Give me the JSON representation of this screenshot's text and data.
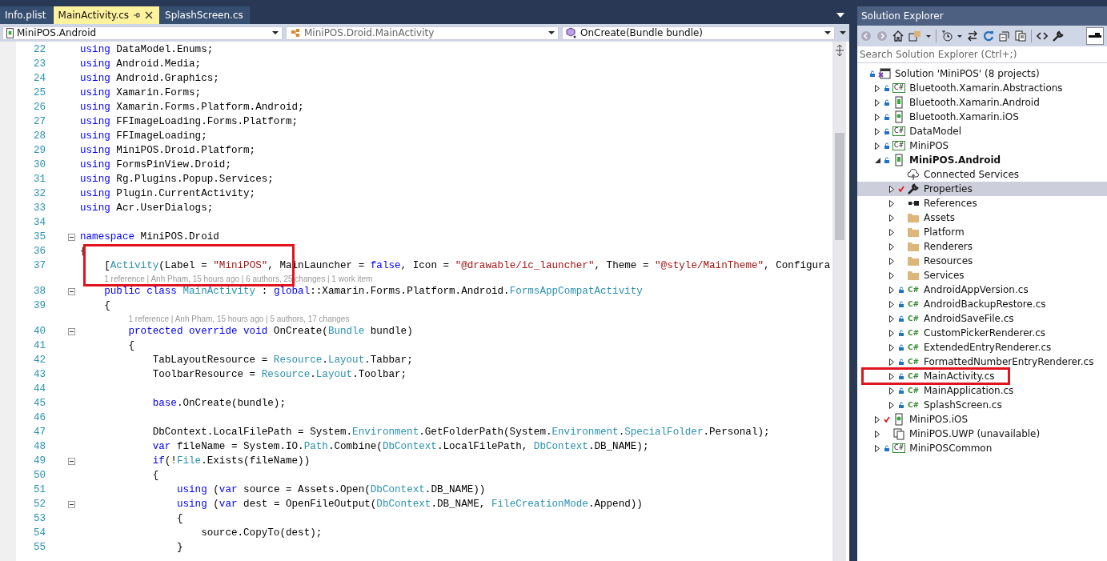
{
  "tabs": [
    {
      "label": "Info.plist",
      "selected": false
    },
    {
      "label": "MainActivity.cs",
      "selected": true
    },
    {
      "label": "SplashScreen.cs",
      "selected": false
    }
  ],
  "nav": [
    {
      "label": "MiniPOS.Android",
      "kind": "project",
      "dimmed": false
    },
    {
      "label": "MiniPOS.Droid.MainActivity",
      "kind": "class",
      "dimmed": true
    },
    {
      "label": "OnCreate(Bundle bundle)",
      "kind": "member",
      "dimmed": false
    }
  ],
  "editor": {
    "lines": [
      {
        "num": "22",
        "fold": false,
        "highlighted": false,
        "tokens": [
          {
            "kind": "kw",
            "t": "using"
          },
          {
            "kind": "plain",
            "t": " DataModel.Enums;"
          }
        ]
      },
      {
        "num": "23",
        "fold": false,
        "highlighted": false,
        "tokens": [
          {
            "kind": "kw",
            "t": "using"
          },
          {
            "kind": "plain",
            "t": " Android.Media;"
          }
        ]
      },
      {
        "num": "24",
        "fold": false,
        "highlighted": false,
        "tokens": [
          {
            "kind": "kw",
            "t": "using"
          },
          {
            "kind": "plain",
            "t": " Android.Graphics;"
          }
        ]
      },
      {
        "num": "25",
        "fold": false,
        "highlighted": false,
        "tokens": [
          {
            "kind": "kw",
            "t": "using"
          },
          {
            "kind": "plain",
            "t": " Xamarin.Forms;"
          }
        ]
      },
      {
        "num": "26",
        "fold": false,
        "highlighted": false,
        "tokens": [
          {
            "kind": "kw",
            "t": "using"
          },
          {
            "kind": "plain",
            "t": " Xamarin.Forms.Platform.Android;"
          }
        ]
      },
      {
        "num": "27",
        "fold": false,
        "highlighted": false,
        "tokens": [
          {
            "kind": "kw",
            "t": "using"
          },
          {
            "kind": "plain",
            "t": " FFImageLoading.Forms.Platform;"
          }
        ]
      },
      {
        "num": "28",
        "fold": false,
        "highlighted": false,
        "tokens": [
          {
            "kind": "kw",
            "t": "using"
          },
          {
            "kind": "plain",
            "t": " FFImageLoading;"
          }
        ]
      },
      {
        "num": "29",
        "fold": false,
        "highlighted": false,
        "tokens": [
          {
            "kind": "kw",
            "t": "using"
          },
          {
            "kind": "plain",
            "t": " MiniPOS.Droid.Platform;"
          }
        ]
      },
      {
        "num": "30",
        "fold": false,
        "highlighted": false,
        "tokens": [
          {
            "kind": "kw",
            "t": "using"
          },
          {
            "kind": "plain",
            "t": " FormsPinView.Droid;"
          }
        ]
      },
      {
        "num": "31",
        "fold": false,
        "highlighted": false,
        "tokens": [
          {
            "kind": "kw",
            "t": "using"
          },
          {
            "kind": "plain",
            "t": " Rg.Plugins.Popup.Services;"
          }
        ]
      },
      {
        "num": "32",
        "fold": false,
        "highlighted": false,
        "tokens": [
          {
            "kind": "kw",
            "t": "using"
          },
          {
            "kind": "plain",
            "t": " Plugin.CurrentActivity;"
          }
        ]
      },
      {
        "num": "33",
        "fold": false,
        "highlighted": false,
        "tokens": [
          {
            "kind": "kw",
            "t": "using"
          },
          {
            "kind": "plain",
            "t": " Acr.UserDialogs;"
          }
        ]
      },
      {
        "num": "34",
        "fold": false,
        "highlighted": false
      },
      {
        "num": "35",
        "fold": true,
        "highlighted": false,
        "tokens": [
          {
            "kind": "kw",
            "t": "namespace"
          },
          {
            "kind": "plain",
            "t": " MiniPOS.Droid"
          }
        ]
      },
      {
        "num": "36",
        "fold": false,
        "highlighted": false,
        "tokens": [
          {
            "kind": "plain",
            "t": "{"
          }
        ]
      },
      {
        "num": "37",
        "fold": false,
        "highlighted": true,
        "tokens": [
          {
            "kind": "plain",
            "t": "    ["
          },
          {
            "kind": "type",
            "t": "Activity"
          },
          {
            "kind": "plain",
            "t": "(Label = "
          },
          {
            "kind": "str",
            "t": "\"MiniPOS\""
          },
          {
            "kind": "plain",
            "t": ", MainLauncher = "
          },
          {
            "kind": "kw",
            "t": "false"
          },
          {
            "kind": "plain",
            "t": ", Icon = "
          },
          {
            "kind": "str",
            "t": "\"@drawable/ic_launcher\""
          },
          {
            "kind": "plain",
            "t": ", Theme = "
          },
          {
            "kind": "str",
            "t": "\"@style/MainTheme\""
          },
          {
            "kind": "plain",
            "t": ", Configura"
          }
        ]
      },
      {
        "num": "38",
        "fold": true,
        "highlighted": false,
        "lens": "1 reference | Anh Pham, 15 hours ago | 6 authors, 25 changes | 1 work item",
        "tokens": [
          {
            "kind": "kw",
            "t": "    public class "
          },
          {
            "kind": "type",
            "t": "MainActivity"
          },
          {
            "kind": "plain",
            "t": " : "
          },
          {
            "kind": "kw",
            "t": "global"
          },
          {
            "kind": "plain",
            "t": "::Xamarin.Forms.Platform.Android."
          },
          {
            "kind": "type",
            "t": "FormsAppCompatActivity"
          }
        ]
      },
      {
        "num": "39",
        "fold": false,
        "highlighted": false,
        "tokens": [
          {
            "kind": "plain",
            "t": "    {"
          }
        ]
      },
      {
        "num": "40",
        "fold": true,
        "highlighted": false,
        "lens": "1 reference | Anh Pham, 15 hours ago | 5 authors, 17 changes",
        "tokens": [
          {
            "kind": "kw",
            "t": "        protected override void"
          },
          {
            "kind": "plain",
            "t": " OnCreate("
          },
          {
            "kind": "type",
            "t": "Bundle"
          },
          {
            "kind": "plain",
            "t": " bundle)"
          }
        ]
      },
      {
        "num": "41",
        "fold": false,
        "highlighted": false,
        "tokens": [
          {
            "kind": "plain",
            "t": "        {"
          }
        ]
      },
      {
        "num": "42",
        "fold": false,
        "highlighted": false,
        "tokens": [
          {
            "kind": "plain",
            "t": "            TabLayoutResource = "
          },
          {
            "kind": "type",
            "t": "Resource"
          },
          {
            "kind": "plain",
            "t": "."
          },
          {
            "kind": "type",
            "t": "Layout"
          },
          {
            "kind": "plain",
            "t": ".Tabbar;"
          }
        ]
      },
      {
        "num": "43",
        "fold": false,
        "highlighted": false,
        "tokens": [
          {
            "kind": "plain",
            "t": "            ToolbarResource = "
          },
          {
            "kind": "type",
            "t": "Resource"
          },
          {
            "kind": "plain",
            "t": "."
          },
          {
            "kind": "type",
            "t": "Layout"
          },
          {
            "kind": "plain",
            "t": ".Toolbar;"
          }
        ]
      },
      {
        "num": "44",
        "fold": false,
        "highlighted": false
      },
      {
        "num": "45",
        "fold": false,
        "highlighted": false,
        "tokens": [
          {
            "kind": "kw",
            "t": "            base"
          },
          {
            "kind": "plain",
            "t": ".OnCreate(bundle);"
          }
        ]
      },
      {
        "num": "46",
        "fold": false,
        "highlighted": false
      },
      {
        "num": "47",
        "fold": false,
        "highlighted": false,
        "tokens": [
          {
            "kind": "plain",
            "t": "            DbContext.LocalFilePath = System."
          },
          {
            "kind": "type",
            "t": "Environment"
          },
          {
            "kind": "plain",
            "t": ".GetFolderPath(System."
          },
          {
            "kind": "type",
            "t": "Environment"
          },
          {
            "kind": "plain",
            "t": "."
          },
          {
            "kind": "type",
            "t": "SpecialFolder"
          },
          {
            "kind": "plain",
            "t": ".Personal);"
          }
        ]
      },
      {
        "num": "48",
        "fold": false,
        "highlighted": false,
        "tokens": [
          {
            "kind": "kw",
            "t": "            var"
          },
          {
            "kind": "plain",
            "t": " fileName = System.IO."
          },
          {
            "kind": "type",
            "t": "Path"
          },
          {
            "kind": "plain",
            "t": ".Combine("
          },
          {
            "kind": "type",
            "t": "DbContext"
          },
          {
            "kind": "plain",
            "t": ".LocalFilePath, "
          },
          {
            "kind": "type",
            "t": "DbContext"
          },
          {
            "kind": "plain",
            "t": ".DB_NAME);"
          }
        ]
      },
      {
        "num": "49",
        "fold": true,
        "highlighted": false,
        "tokens": [
          {
            "kind": "kw",
            "t": "            if"
          },
          {
            "kind": "plain",
            "t": "(!"
          },
          {
            "kind": "type",
            "t": "File"
          },
          {
            "kind": "plain",
            "t": ".Exists(fileName))"
          }
        ]
      },
      {
        "num": "50",
        "fold": false,
        "highlighted": false,
        "tokens": [
          {
            "kind": "plain",
            "t": "            {"
          }
        ]
      },
      {
        "num": "51",
        "fold": false,
        "highlighted": false,
        "tokens": [
          {
            "kind": "kw",
            "t": "                using"
          },
          {
            "kind": "plain",
            "t": " ("
          },
          {
            "kind": "kw",
            "t": "var"
          },
          {
            "kind": "plain",
            "t": " source = Assets.Open("
          },
          {
            "kind": "type",
            "t": "DbContext"
          },
          {
            "kind": "plain",
            "t": ".DB_NAME))"
          }
        ]
      },
      {
        "num": "52",
        "fold": true,
        "highlighted": false,
        "tokens": [
          {
            "kind": "kw",
            "t": "                using"
          },
          {
            "kind": "plain",
            "t": " ("
          },
          {
            "kind": "kw",
            "t": "var"
          },
          {
            "kind": "plain",
            "t": " dest = OpenFileOutput("
          },
          {
            "kind": "type",
            "t": "DbContext"
          },
          {
            "kind": "plain",
            "t": ".DB_NAME, "
          },
          {
            "kind": "type",
            "t": "FileCreationMode"
          },
          {
            "kind": "plain",
            "t": ".Append))"
          }
        ]
      },
      {
        "num": "53",
        "fold": false,
        "highlighted": false,
        "tokens": [
          {
            "kind": "plain",
            "t": "                {"
          }
        ]
      },
      {
        "num": "54",
        "fold": false,
        "highlighted": false,
        "tokens": [
          {
            "kind": "plain",
            "t": "                    source.CopyTo(dest);"
          }
        ]
      },
      {
        "num": "55",
        "fold": false,
        "highlighted": false,
        "tokens": [
          {
            "kind": "plain",
            "t": "                }"
          }
        ]
      }
    ]
  },
  "explorer": {
    "title": "Solution Explorer",
    "search": {
      "placeholder": "Search Solution Explorer (Ctrl+;)"
    },
    "tree": [
      {
        "label": "Solution 'MiniPOS' (8 projects)",
        "kind": "solution",
        "locked": true,
        "pending": false,
        "bold": false,
        "selected": false,
        "highlighted": false,
        "children": [
          {
            "label": "Bluetooth.Xamarin.Abstractions",
            "kind": "csproj",
            "badge": "C#",
            "locked": true,
            "pending": false,
            "bold": false,
            "selected": false,
            "highlighted": false,
            "expanded": false
          },
          {
            "label": "Bluetooth.Xamarin.Android",
            "kind": "android",
            "locked": true,
            "pending": false,
            "bold": false,
            "selected": false,
            "highlighted": false,
            "expanded": false
          },
          {
            "label": "Bluetooth.Xamarin.iOS",
            "kind": "ios",
            "locked": true,
            "pending": false,
            "bold": false,
            "selected": false,
            "highlighted": false,
            "expanded": false
          },
          {
            "label": "DataModel",
            "kind": "csproj",
            "badge": "C#",
            "locked": true,
            "pending": false,
            "bold": false,
            "selected": false,
            "highlighted": false,
            "expanded": false
          },
          {
            "label": "MiniPOS",
            "kind": "csproj",
            "badge": "C#",
            "locked": true,
            "pending": false,
            "bold": false,
            "selected": false,
            "highlighted": false,
            "expanded": false
          },
          {
            "label": "MiniPOS.Android",
            "kind": "android",
            "locked": true,
            "pending": false,
            "bold": true,
            "selected": false,
            "highlighted": false,
            "expanded": true,
            "children": [
              {
                "label": "Connected Services",
                "kind": "connected",
                "locked": false,
                "pending": false,
                "bold": false,
                "selected": false,
                "highlighted": false
              },
              {
                "label": "Properties",
                "kind": "wrench",
                "locked": false,
                "pending": true,
                "bold": false,
                "selected": true,
                "highlighted": false,
                "expanded": false
              },
              {
                "label": "References",
                "kind": "references",
                "locked": false,
                "pending": false,
                "bold": false,
                "selected": false,
                "highlighted": false,
                "expanded": false
              },
              {
                "label": "Assets",
                "kind": "folder",
                "locked": false,
                "pending": false,
                "bold": false,
                "selected": false,
                "highlighted": false,
                "expanded": false
              },
              {
                "label": "Platform",
                "kind": "folder",
                "locked": false,
                "pending": false,
                "bold": false,
                "selected": false,
                "highlighted": false,
                "expanded": false
              },
              {
                "label": "Renderers",
                "kind": "folder",
                "locked": false,
                "pending": false,
                "bold": false,
                "selected": false,
                "highlighted": false,
                "expanded": false
              },
              {
                "label": "Resources",
                "kind": "folder",
                "locked": false,
                "pending": false,
                "bold": false,
                "selected": false,
                "highlighted": false,
                "expanded": false
              },
              {
                "label": "Services",
                "kind": "folder",
                "locked": false,
                "pending": false,
                "bold": false,
                "selected": false,
                "highlighted": false,
                "expanded": false
              },
              {
                "label": "AndroidAppVersion.cs",
                "kind": "cs",
                "badge": "C#",
                "locked": true,
                "pending": false,
                "bold": false,
                "selected": false,
                "highlighted": false,
                "expanded": false
              },
              {
                "label": "AndroidBackupRestore.cs",
                "kind": "cs",
                "badge": "C#",
                "locked": true,
                "pending": false,
                "bold": false,
                "selected": false,
                "highlighted": false,
                "expanded": false
              },
              {
                "label": "AndroidSaveFile.cs",
                "kind": "cs",
                "badge": "C#",
                "locked": true,
                "pending": false,
                "bold": false,
                "selected": false,
                "highlighted": false,
                "expanded": false
              },
              {
                "label": "CustomPickerRenderer.cs",
                "kind": "cs",
                "badge": "C#",
                "locked": true,
                "pending": false,
                "bold": false,
                "selected": false,
                "highlighted": false,
                "expanded": false
              },
              {
                "label": "ExtendedEntryRenderer.cs",
                "kind": "cs",
                "badge": "C#",
                "locked": true,
                "pending": false,
                "bold": false,
                "selected": false,
                "highlighted": false,
                "expanded": false
              },
              {
                "label": "FormattedNumberEntryRenderer.cs",
                "kind": "cs",
                "badge": "C#",
                "locked": true,
                "pending": false,
                "bold": false,
                "selected": false,
                "highlighted": false,
                "expanded": false
              },
              {
                "label": "MainActivity.cs",
                "kind": "cs",
                "badge": "C#",
                "locked": true,
                "pending": false,
                "bold": false,
                "selected": false,
                "highlighted": true,
                "expanded": false
              },
              {
                "label": "MainApplication.cs",
                "kind": "cs",
                "badge": "C#",
                "locked": true,
                "pending": false,
                "bold": false,
                "selected": false,
                "highlighted": false,
                "expanded": false
              },
              {
                "label": "SplashScreen.cs",
                "kind": "cs",
                "badge": "C#",
                "locked": true,
                "pending": false,
                "bold": false,
                "selected": false,
                "highlighted": false,
                "expanded": false
              }
            ]
          },
          {
            "label": "MiniPOS.iOS",
            "kind": "ios",
            "locked": false,
            "pending": true,
            "bold": false,
            "selected": false,
            "highlighted": false,
            "expanded": false
          },
          {
            "label": "MiniPOS.UWP (unavailable)",
            "kind": "uwp",
            "locked": false,
            "pending": false,
            "bold": false,
            "selected": false,
            "highlighted": false,
            "expanded": false
          },
          {
            "label": "MiniPOSCommon",
            "kind": "csproj",
            "badge": "C#",
            "locked": true,
            "pending": false,
            "bold": false,
            "selected": false,
            "highlighted": false,
            "expanded": false
          }
        ]
      }
    ]
  }
}
